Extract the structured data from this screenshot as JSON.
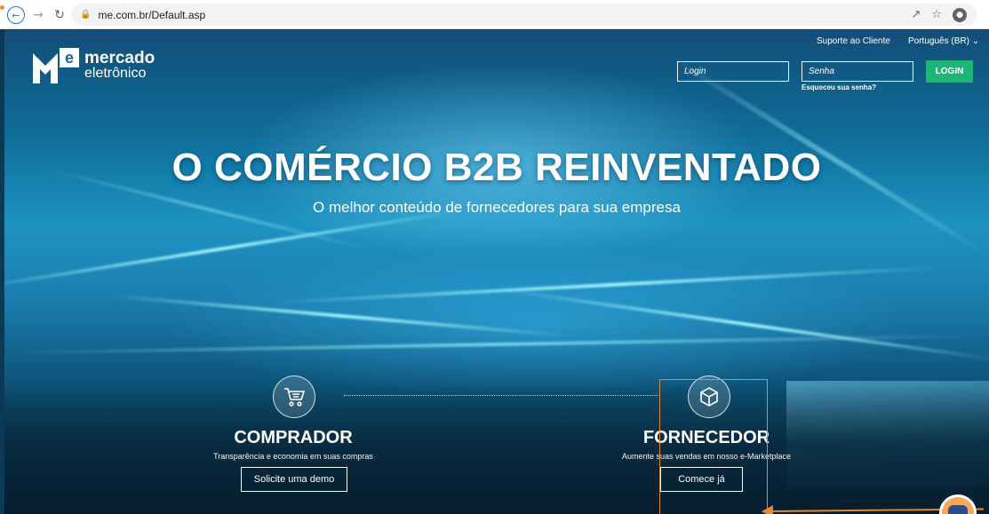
{
  "browser": {
    "url": "me.com.br/Default.asp"
  },
  "header": {
    "logo_line1": "mercado",
    "logo_line2": "eletrônico",
    "support_link": "Suporte ao Cliente",
    "language": "Português (BR)",
    "login_placeholder": "Login",
    "password_placeholder": "Senha",
    "forgot_password": "Esqueceu sua senha?",
    "login_button": "LOGIN"
  },
  "hero": {
    "headline": "O COMÉRCIO B2B REINVENTADO",
    "subheadline": "O melhor conteúdo de fornecedores para sua empresa"
  },
  "buyer": {
    "title": "COMPRADOR",
    "subtitle": "Transparência e economia em suas compras",
    "button": "Solicite uma demo",
    "icon": "cart-icon"
  },
  "supplier": {
    "title": "FORNECEDOR",
    "subtitle": "Aumente suas vendas em nosso e-Marketplace",
    "button": "Comece já",
    "icon": "box-icon"
  },
  "colors": {
    "accent_green": "#1fb57a",
    "annotation_orange": "#e8882d",
    "hero_blue": "#1d93c2"
  }
}
